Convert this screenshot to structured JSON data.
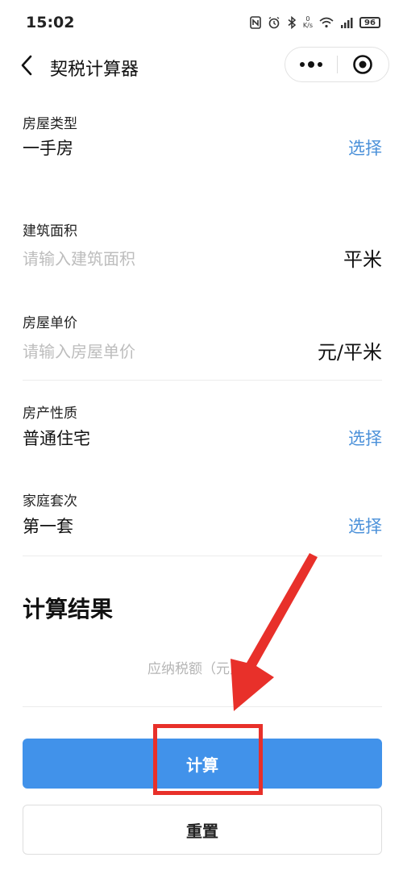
{
  "status_bar": {
    "time": "15:02",
    "speed_value": "0",
    "speed_unit": "K/s",
    "battery": "96"
  },
  "nav": {
    "title": "契税计算器"
  },
  "form": {
    "house_type": {
      "label": "房屋类型",
      "value": "一手房",
      "action": "选择"
    },
    "area": {
      "label": "建筑面积",
      "placeholder": "请输入建筑面积",
      "unit": "平米"
    },
    "unit_price": {
      "label": "房屋单价",
      "placeholder": "请输入房屋单价",
      "unit": "元/平米"
    },
    "property_nature": {
      "label": "房产性质",
      "value": "普通住宅",
      "action": "选择"
    },
    "family_count": {
      "label": "家庭套次",
      "value": "第一套",
      "action": "选择"
    }
  },
  "result": {
    "title": "计算结果",
    "tax_placeholder": "应纳税额（元）"
  },
  "buttons": {
    "calculate": "计算",
    "reset": "重置"
  },
  "colors": {
    "accent": "#4192ea",
    "link": "#4a90d9",
    "annotation": "#e8302a"
  }
}
